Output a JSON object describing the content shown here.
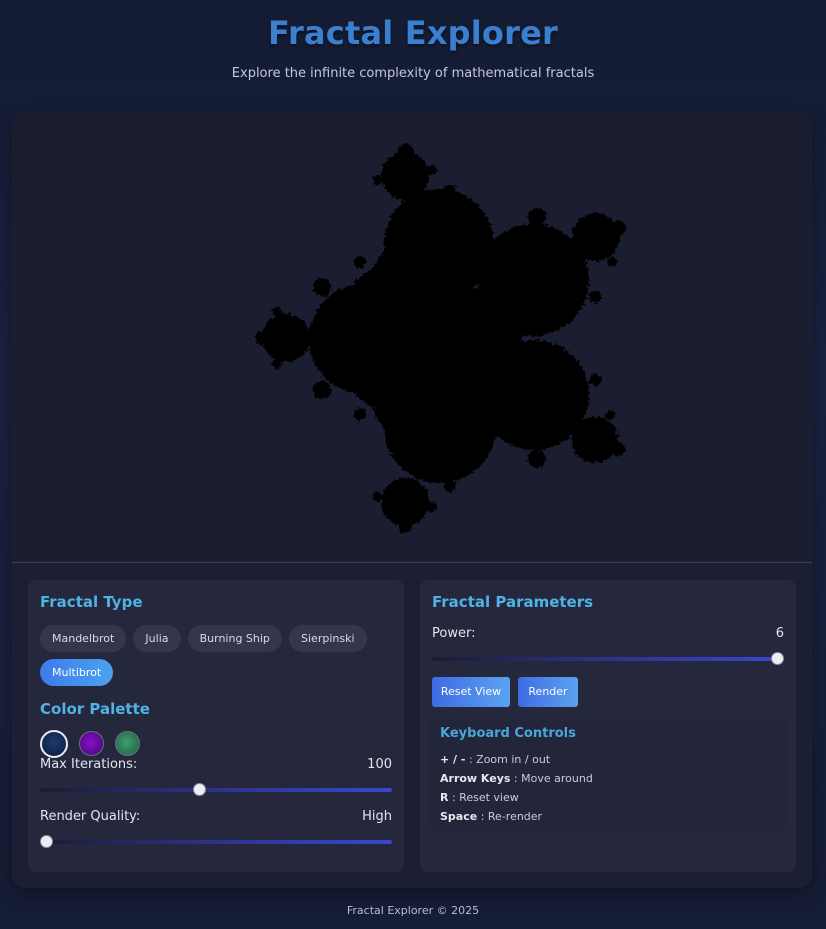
{
  "header": {
    "title": "Fractal Explorer",
    "subtitle": "Explore the infinite complexity of mathematical fractals"
  },
  "canvas": {
    "background": "#1b1d31",
    "fractal_color": "#000000"
  },
  "fractal_type": {
    "title": "Fractal Type",
    "options": [
      "Mandelbrot",
      "Julia",
      "Burning Ship",
      "Sierpinski",
      "Multibrot"
    ],
    "selected": "Multibrot"
  },
  "color_palette": {
    "title": "Color Palette",
    "swatches": [
      {
        "name": "blue",
        "color": "#1e3a6e",
        "selected": true
      },
      {
        "name": "purple",
        "color": "#8a10c8",
        "selected": false
      },
      {
        "name": "green",
        "color": "#3da070",
        "selected": false
      }
    ]
  },
  "max_iterations": {
    "label": "Max Iterations:",
    "value": "100",
    "fraction": 0.45
  },
  "render_quality": {
    "label": "Render Quality:",
    "value": "High",
    "fraction": 0.0
  },
  "parameters": {
    "title": "Fractal Parameters",
    "power_label": "Power:",
    "power_value": "6",
    "power_fraction": 1.0,
    "reset_label": "Reset View",
    "render_label": "Render"
  },
  "keyboard": {
    "title": "Keyboard Controls",
    "rows": [
      {
        "key": "+ / -",
        "desc": ": Zoom in / out"
      },
      {
        "key": "Arrow Keys",
        "desc": ": Move around"
      },
      {
        "key": "R",
        "desc": ": Reset view"
      },
      {
        "key": "Space",
        "desc": ": Re-render"
      }
    ]
  },
  "footer": {
    "text": "Fractal Explorer © 2025"
  },
  "colors": {
    "accent": "#4fb3e6",
    "title": "#3a7fd0",
    "button": "#3f6be4"
  }
}
